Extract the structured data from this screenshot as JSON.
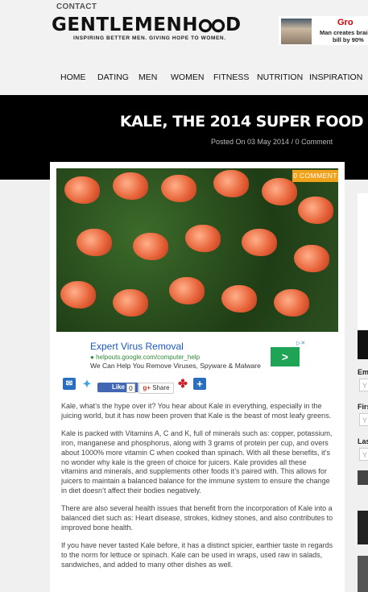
{
  "header": {
    "contact": "CONTACT",
    "logo_left": "GENTLEMENH",
    "logo_right": "D",
    "tagline": "INSPIRING BETTER MEN. GIVING HOPE TO WOMEN.",
    "ad_title": "Gro",
    "ad_line1": "Man creates brain",
    "ad_line2": "bill by 90%"
  },
  "nav": [
    "HOME",
    "DATING",
    "MEN",
    "WOMEN",
    "FITNESS",
    "NUTRITION",
    "INSPIRATION"
  ],
  "post": {
    "title": "KALE, THE 2014 SUPER FOOD",
    "meta": "Posted On 03 May 2014 / 0 Comment",
    "comment_badge": "0 COMMENT"
  },
  "ad": {
    "headline": "Expert Virus Removal",
    "url": "helpouts.google.com/computer_help",
    "desc": "We Can Help You Remove Viruses, Spyware & Malware",
    "cta": ">"
  },
  "share": {
    "like": "Like",
    "like_count": "0",
    "gplus_count": "0",
    "share": "Share"
  },
  "article": [
    "Kale, what’s the hype over it?  You hear about Kale in everything, especially in the juicing world, but it has now been proven that Kale is the beast of most leafy greens.",
    "Kale is packed with Vitamins A, C and K, full of minerals such as: copper, potassium, iron, manganese and phosphorus, along with 3 grams of protein per cup, and overs about 1000% more vitamin C when cooked than spinach.  With all these benefits, it’s no wonder why kale is the green of choice for juicers.  Kale provides all these vitamins and minerals, and supplements other foods it’s paired with.  This allows for juicers to maintain a balanced balance for the immune system to ensure the change in diet doesn’t affect their bodies negatively.",
    "There are also several health issues that benefit from the incorporation of Kale into a balanced diet such as: Heart disease, strokes, kidney stones, and also contributes to improved bone health.",
    "If you have never tasted Kale before, it has a distinct spicier, earthier taste in regards to the norm for lettuce or spinach.  Kale can be used in wraps, used raw in salads, sandwiches, and added to many other dishes as well."
  ],
  "sidebar": {
    "label_email": "Em",
    "label_first": "Firs",
    "label_last": "Las",
    "placeholder": "Y"
  }
}
